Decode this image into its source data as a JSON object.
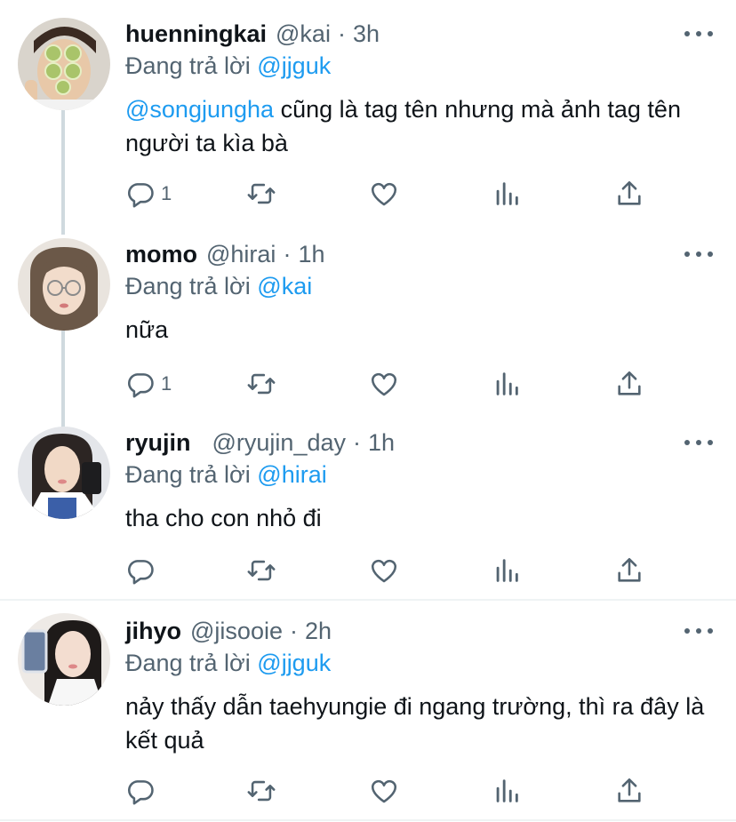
{
  "tweets": [
    {
      "name": "huenningkai",
      "handle": "@kai",
      "time": "3h",
      "replying_label": "Đang trả lời",
      "replying_to": "@jjguk",
      "mention": "@songjungha",
      "text": "cũng là tag tên nhưng mà ảnh tag tên người ta kìa bà",
      "reply_count": "1"
    },
    {
      "name": "momo",
      "handle": "@hirai",
      "time": "1h",
      "replying_label": "Đang trả lời",
      "replying_to": "@kai",
      "text": "nữa",
      "reply_count": "1"
    },
    {
      "name": "ryujin",
      "handle": "@ryujin_day",
      "time": "1h",
      "replying_label": "Đang trả lời",
      "replying_to": "@hirai",
      "text": "tha cho con nhỏ đi",
      "reply_count": ""
    },
    {
      "name": "jihyo",
      "handle": "@jisooie",
      "time": "2h",
      "replying_label": "Đang trả lời",
      "replying_to": "@jjguk",
      "text": "nảy thấy dẫn taehyungie đi ngang trường, thì ra đây là kết quả",
      "reply_count": ""
    }
  ],
  "separator": "·",
  "icons": [
    "reply-icon",
    "retweet-icon",
    "like-icon",
    "analytics-icon",
    "share-icon",
    "more-icon"
  ],
  "colors": {
    "accent": "#1d9bf0",
    "muted": "#536471",
    "text": "#0f1419",
    "divider": "#eff3f4"
  }
}
